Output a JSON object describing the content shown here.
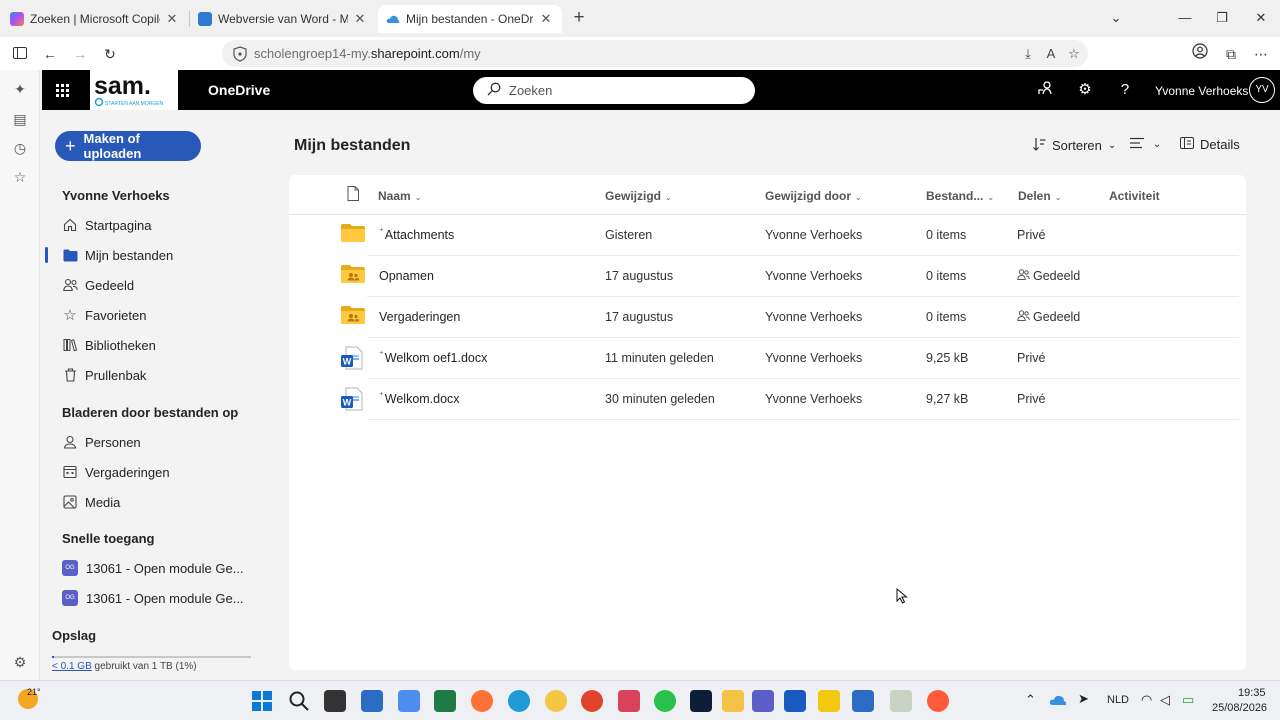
{
  "browser": {
    "tabs": [
      {
        "title": "Zoeken | Microsoft Copilot",
        "active": false
      },
      {
        "title": "Webversie van Word - Microsof",
        "active": false
      },
      {
        "title": "Mijn bestanden - OneDrive",
        "active": true
      }
    ],
    "address": {
      "prefix": "scholengroep14-my.",
      "domain": "sharepoint.com",
      "suffix": "/my"
    }
  },
  "suite": {
    "app_name": "OneDrive",
    "logo_text": "sam.",
    "logo_tagline": "STARTEN AAN MORGEN",
    "search_placeholder": "Zoeken",
    "user_name": "Yvonne Verhoeks",
    "user_initials": "YV"
  },
  "nav": {
    "create_label": "Maken of uploaden",
    "user_section": "Yvonne Verhoeks",
    "items": [
      {
        "label": "Startpagina",
        "icon": "home-icon"
      },
      {
        "label": "Mijn bestanden",
        "icon": "folder-icon",
        "selected": true
      },
      {
        "label": "Gedeeld",
        "icon": "people-icon"
      },
      {
        "label": "Favorieten",
        "icon": "star-icon"
      },
      {
        "label": "Bibliotheken",
        "icon": "library-icon"
      },
      {
        "label": "Prullenbak",
        "icon": "trash-icon"
      }
    ],
    "browse_section": "Bladeren door bestanden op",
    "browse_items": [
      {
        "label": "Personen",
        "icon": "person-icon"
      },
      {
        "label": "Vergaderingen",
        "icon": "calendar-icon"
      },
      {
        "label": "Media",
        "icon": "image-icon"
      }
    ],
    "quick_section": "Snelle toegang",
    "quick_items": [
      {
        "label": "13061 - Open module Ge...",
        "badge": "OG"
      },
      {
        "label": "13061 - Open module Ge...",
        "badge": "OG"
      }
    ],
    "storage_section": "Opslag",
    "storage_used": "< 0.1 GB",
    "storage_rest": " gebruikt van 1 TB (1%)",
    "storage_fraction": 0.01
  },
  "main": {
    "title": "Mijn bestanden",
    "sort_label": "Sorteren",
    "details_label": "Details",
    "columns": {
      "name": "Naam",
      "modified": "Gewijzigd",
      "modified_by": "Gewijzigd door",
      "size": "Bestand...",
      "sharing": "Delen",
      "activity": "Activiteit"
    },
    "files": [
      {
        "name": "Attachments",
        "type": "folder",
        "modified": "Gisteren",
        "modified_by": "Yvonne Verhoeks",
        "size": "0 items",
        "sharing": "Privé",
        "shared": false,
        "new": true
      },
      {
        "name": "Opnamen",
        "type": "shared-folder",
        "modified": "17 augustus",
        "modified_by": "Yvonne Verhoeks",
        "size": "0 items",
        "sharing": "Gedeeld",
        "shared": true,
        "new": false
      },
      {
        "name": "Vergaderingen",
        "type": "shared-folder",
        "modified": "17 augustus",
        "modified_by": "Yvonne Verhoeks",
        "size": "0 items",
        "sharing": "Gedeeld",
        "shared": true,
        "new": false
      },
      {
        "name": "Welkom oef1.docx",
        "type": "word",
        "modified": "11 minuten geleden",
        "modified_by": "Yvonne Verhoeks",
        "size": "9,25 kB",
        "sharing": "Privé",
        "shared": false,
        "new": true
      },
      {
        "name": "Welkom.docx",
        "type": "word",
        "modified": "30 minuten geleden",
        "modified_by": "Yvonne Verhoeks",
        "size": "9,27 kB",
        "sharing": "Privé",
        "shared": false,
        "new": true
      }
    ]
  },
  "taskbar": {
    "weather": "21°",
    "language": "NLD",
    "time": "19:35",
    "date": "25/08/2026"
  }
}
